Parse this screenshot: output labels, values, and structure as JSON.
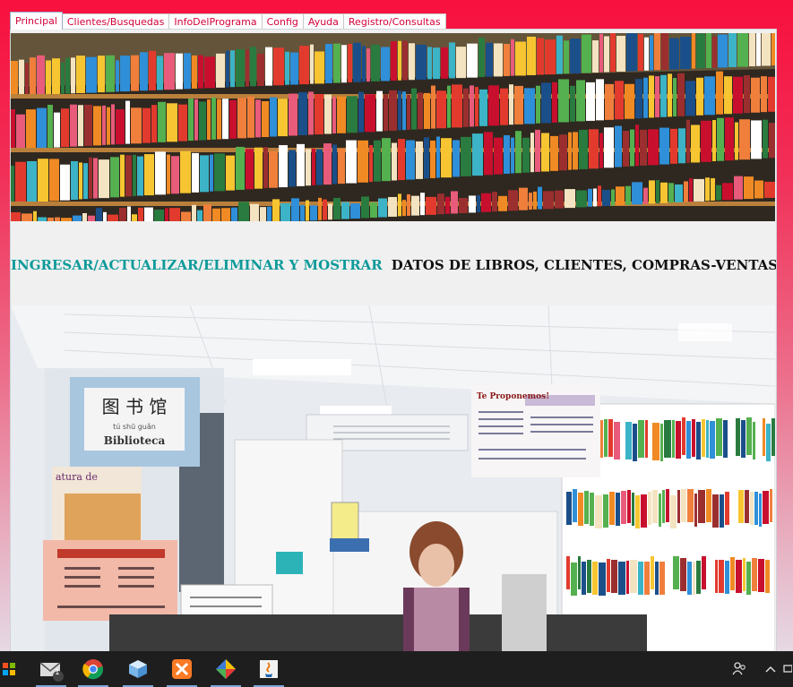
{
  "tabs": [
    "Principal",
    "Clientes/Busquedas",
    "InfoDelPrograma",
    "Config",
    "Ayuda",
    "Registro/Consultas"
  ],
  "active_tab": "Principal",
  "caption": {
    "highlight": "INGRESAR/ACTUALIZAR/ELIMINAR Y MOSTRAR",
    "rest": "DATOS DE LIBROS, CLIENTES, COMPRAS-VENTAS Y RESERVAS."
  },
  "photo": {
    "sign_chinese": "图 书 馆",
    "sign_pinyin": "tú shū guǎn",
    "sign_word": "Biblioteca",
    "poster_title": "Te Proponemos!",
    "left_poster_text": "atura de\ny la salud\nr vez"
  },
  "taskbar": {
    "mail_badge": "1",
    "colors": {
      "bar": "#1e1e1e",
      "accent": "#7ca7d8"
    }
  }
}
